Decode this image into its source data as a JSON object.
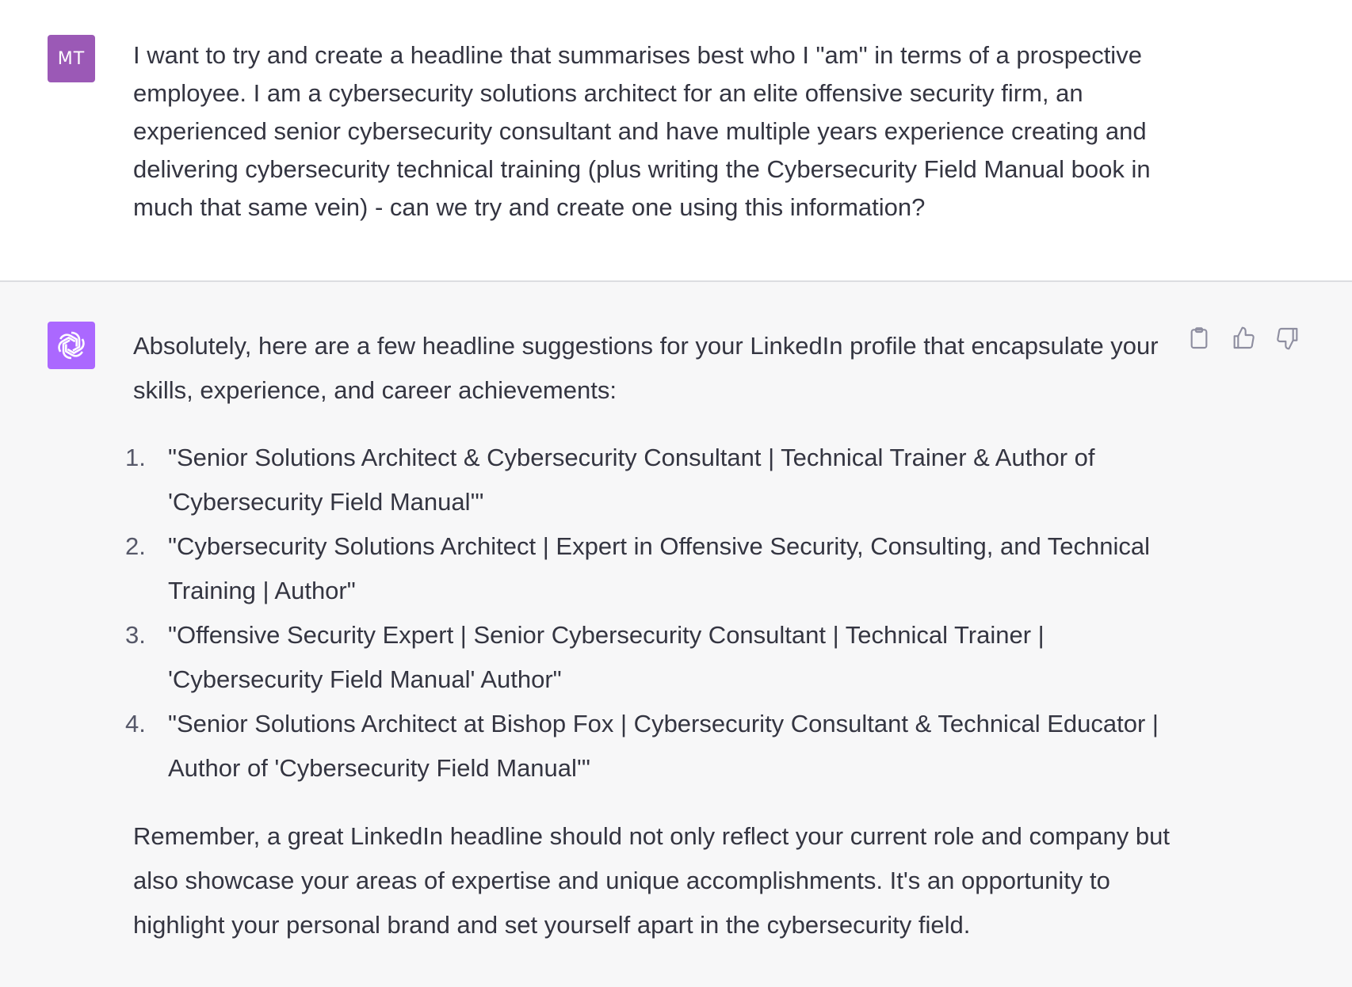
{
  "user_message": {
    "avatar_initials": "MT",
    "text": "I want to try and create a headline that summarises best who I \"am\" in terms of a prospective employee. I am a cybersecurity solutions architect for an elite offensive security firm, an experienced senior cybersecurity consultant and have multiple years experience creating and delivering cybersecurity technical training (plus writing the Cybersecurity Field Manual book in much that same vein) - can we try and create one using this information?"
  },
  "assistant_message": {
    "avatar_icon": "openai-logo-icon",
    "intro": "Absolutely, here are a few headline suggestions for your LinkedIn profile that encapsulate your skills, experience, and career achievements:",
    "items": [
      {
        "num": "1.",
        "text": "\"Senior Solutions Architect & Cybersecurity Consultant | Technical Trainer & Author of 'Cybersecurity Field Manual'\""
      },
      {
        "num": "2.",
        "text": "\"Cybersecurity Solutions Architect | Expert in Offensive Security, Consulting, and Technical Training | Author\""
      },
      {
        "num": "3.",
        "text": "\"Offensive Security Expert | Senior Cybersecurity Consultant | Technical Trainer | 'Cybersecurity Field Manual' Author\""
      },
      {
        "num": "4.",
        "text": "\"Senior Solutions Architect at Bishop Fox | Cybersecurity Consultant & Technical Educator | Author of 'Cybersecurity Field Manual'\""
      }
    ],
    "outro": "Remember, a great LinkedIn headline should not only reflect your current role and company but also showcase your areas of expertise and unique accomplishments. It's an opportunity to highlight your personal brand and set yourself apart in the cybersecurity field."
  },
  "actions": {
    "copy_icon": "clipboard-icon",
    "like_icon": "thumbs-up-icon",
    "dislike_icon": "thumbs-down-icon"
  },
  "colors": {
    "user_avatar": "#9b59b6",
    "bot_avatar": "#ab68ff",
    "assistant_bg": "#f7f7f8",
    "text": "#343541"
  }
}
